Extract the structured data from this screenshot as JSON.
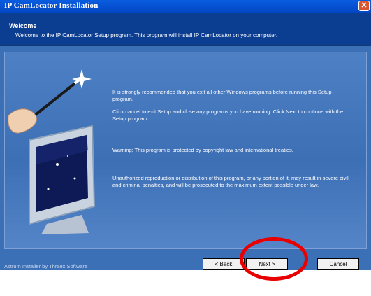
{
  "window": {
    "title": "IP CamLocator Installation",
    "close_label": "✕"
  },
  "header": {
    "title": "Welcome",
    "subtitle": "Welcome to the IP CamLocator Setup program. This program will install IP CamLocator on your computer."
  },
  "content": {
    "paragraphs": [
      "It is strongly recommended that you exit all other Windows programs before running this Setup program.",
      "Click cancel to exit Setup and close any programs you have running. Click Next to continue with the Setup program.",
      "Warning: This program is protected by copyright law and international treaties.",
      "Unauthorized reproduction or distribution of this program, or any portion of it, may result in severe civil and criminal penalties, and will be prosecuted to the maximum extent possible under law."
    ]
  },
  "footer": {
    "credit_prefix": "Astrum Installer by",
    "credit_link": "Thraex Software",
    "back_label": "< Back",
    "next_label": "Next >",
    "cancel_label": "Cancel"
  },
  "colors": {
    "accent_highlight": "#e80000",
    "title_bar": "#0a5de0",
    "panel": "#3b6fb6"
  },
  "icons": [
    "close-icon",
    "magic-wand-icon",
    "monitor-icon"
  ]
}
